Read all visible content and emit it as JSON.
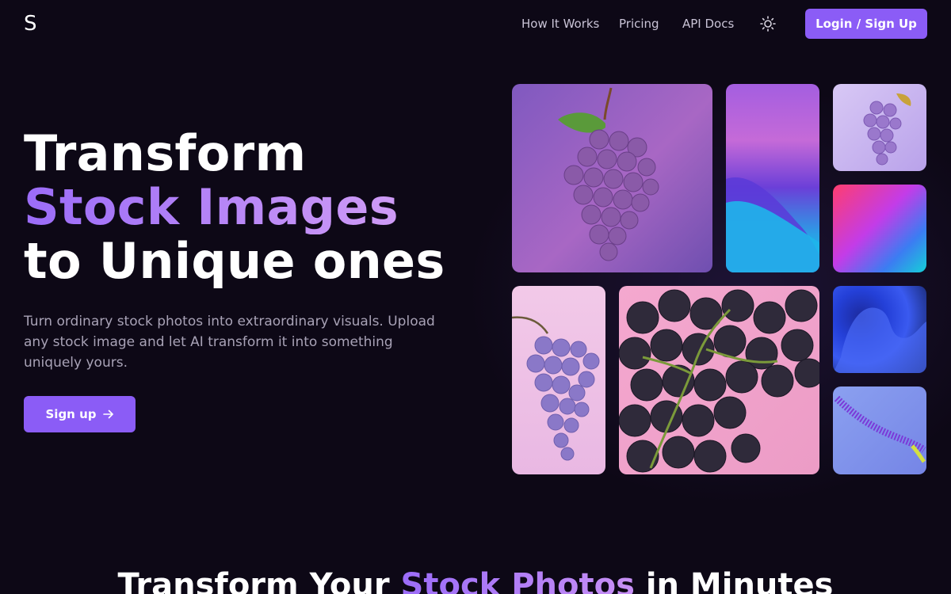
{
  "nav": {
    "logo": "S",
    "links": [
      "How It Works",
      "Pricing",
      "API Docs"
    ],
    "theme_icon": "sun-icon",
    "login_label": "Login / Sign Up"
  },
  "hero": {
    "title_line1": "Transform",
    "title_line2": "Stock Images",
    "title_line3": "to Unique ones",
    "subtitle": "Turn ordinary stock photos into extraordinary visuals. Upload any stock image and let AI transform it into something uniquely yours.",
    "signup_label": "Sign up",
    "signup_icon": "arrow-right-icon"
  },
  "gallery": {
    "tiles": [
      {
        "subject": "grape-bunch-illustration"
      },
      {
        "subject": "purple-blue-wave-abstract"
      },
      {
        "subject": "small-grape-illustration"
      },
      {
        "subject": "pink-blue-gradient"
      },
      {
        "subject": "grape-bunch-photo"
      },
      {
        "subject": "dark-grapes-closeup"
      },
      {
        "subject": "blue-fluid-3d-abstract"
      },
      {
        "subject": "purple-ribbon-abstract"
      }
    ]
  },
  "section": {
    "title_before": "Transform Your ",
    "title_accent": "Stock Photos",
    "title_after": " in Minutes"
  },
  "colors": {
    "background": "#0d0816",
    "accent": "#8b5cf6",
    "muted_text": "#a8a2b6"
  }
}
